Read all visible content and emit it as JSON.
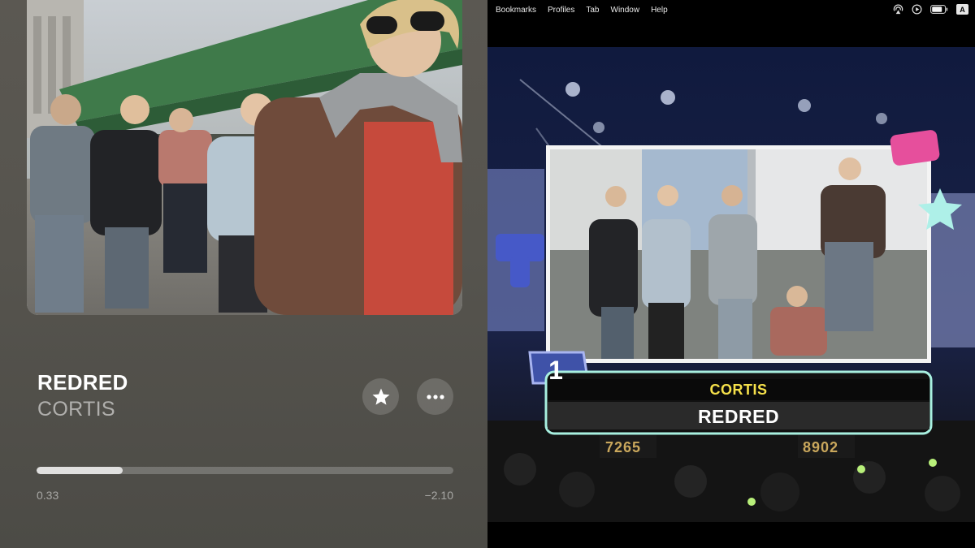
{
  "player": {
    "track_title": "REDRED",
    "artist": "CORTIS",
    "elapsed": "0.33",
    "remaining": "−2.10",
    "progress_fraction": 0.207,
    "favorite_icon": "star-icon",
    "more_icon": "ellipsis-icon"
  },
  "menubar": {
    "items": [
      "Bookmarks",
      "Profiles",
      "Tab",
      "Window",
      "Help"
    ],
    "status_icons": [
      "airplay-icon",
      "play-circle-icon",
      "battery-icon",
      "input-source-icon"
    ],
    "input_source": "A"
  },
  "video": {
    "rank": "1",
    "chart_artist": "CORTIS",
    "chart_song": "REDRED",
    "score_left": "7265",
    "score_right": "8902",
    "accent_colors": {
      "frame": "#a8f0e0",
      "artist_text": "#f5e04a",
      "rank_badge": "#3f52a8"
    }
  }
}
